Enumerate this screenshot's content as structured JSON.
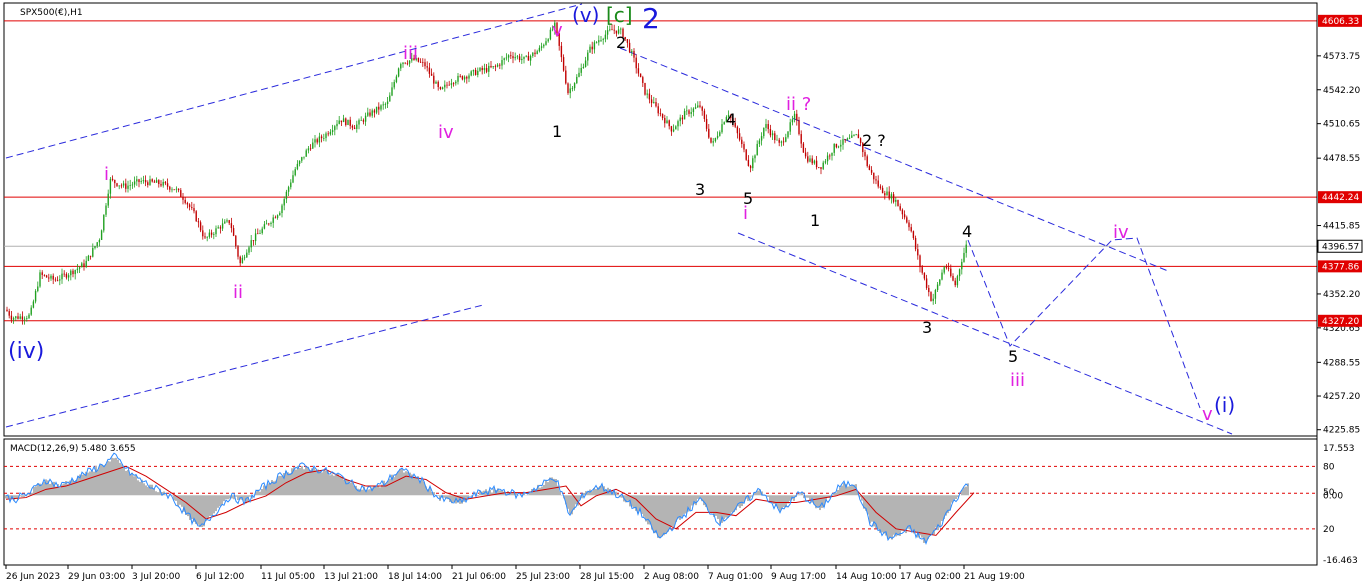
{
  "chart_data": {
    "type": "candlestick",
    "symbol": "SPX500(€),H1",
    "macd_label": "MACD(12,26,9) 5.480 3.655",
    "price_axis": {
      "ylim": [
        4220,
        4622
      ],
      "ticks": [
        4573.75,
        4542.2,
        4510.65,
        4478.55,
        4415.85,
        4352.2,
        4320.65,
        4288.55,
        4257.2,
        4225.85
      ]
    },
    "horizontal_levels": [
      {
        "price": 4606.33,
        "label": "4606.33",
        "color": "#e00000"
      },
      {
        "price": 4442.24,
        "label": "4442.24",
        "color": "#e00000"
      },
      {
        "price": 4377.86,
        "label": "4377.86",
        "color": "#e00000"
      },
      {
        "price": 4327.2,
        "label": "4327.20",
        "color": "#e00000"
      }
    ],
    "current_price": {
      "price": 4396.57,
      "label": "4396.57"
    },
    "macd_axis": {
      "ylim": [
        -18,
        20
      ],
      "ticks": [
        {
          "label": "17.553",
          "value": 17.55
        },
        {
          "label": "80",
          "value": 12
        },
        {
          "label": "50",
          "value": 4.2
        },
        {
          "label": "0.00",
          "value": 3.2
        },
        {
          "label": "20",
          "value": -7
        },
        {
          "label": "-16.463",
          "value": -16.46
        }
      ],
      "dashed_levels": [
        12,
        3.8,
        -7
      ]
    },
    "time_axis": [
      "26 Jun 2023",
      "29 Jun 03:00",
      "3 Jul 20:00",
      "6 Jul 12:00",
      "11 Jul 05:00",
      "13 Jul 21:00",
      "18 Jul 14:00",
      "21 Jul 06:00",
      "25 Jul 23:00",
      "28 Jul 15:00",
      "2 Aug 08:00",
      "7 Aug 01:00",
      "9 Aug 17:00",
      "14 Aug 10:00",
      "17 Aug 02:00",
      "21 Aug 19:00"
    ],
    "price_path": [
      [
        0,
        4345
      ],
      [
        12,
        4330
      ],
      [
        30,
        4332
      ],
      [
        40,
        4370
      ],
      [
        55,
        4365
      ],
      [
        70,
        4372
      ],
      [
        85,
        4380
      ],
      [
        100,
        4405
      ],
      [
        110,
        4458
      ],
      [
        125,
        4452
      ],
      [
        140,
        4457
      ],
      [
        160,
        4455
      ],
      [
        175,
        4450
      ],
      [
        185,
        4440
      ],
      [
        195,
        4425
      ],
      [
        205,
        4403
      ],
      [
        220,
        4415
      ],
      [
        230,
        4420
      ],
      [
        240,
        4380
      ],
      [
        250,
        4400
      ],
      [
        265,
        4415
      ],
      [
        280,
        4430
      ],
      [
        295,
        4468
      ],
      [
        310,
        4490
      ],
      [
        325,
        4500
      ],
      [
        340,
        4515
      ],
      [
        355,
        4508
      ],
      [
        370,
        4520
      ],
      [
        388,
        4530
      ],
      [
        400,
        4568
      ],
      [
        415,
        4570
      ],
      [
        425,
        4565
      ],
      [
        440,
        4540
      ],
      [
        450,
        4550
      ],
      [
        465,
        4555
      ],
      [
        480,
        4560
      ],
      [
        495,
        4563
      ],
      [
        510,
        4575
      ],
      [
        525,
        4570
      ],
      [
        540,
        4580
      ],
      [
        555,
        4602
      ],
      [
        568,
        4540
      ],
      [
        578,
        4555
      ],
      [
        590,
        4580
      ],
      [
        600,
        4590
      ],
      [
        612,
        4598
      ],
      [
        622,
        4596
      ],
      [
        632,
        4575
      ],
      [
        645,
        4540
      ],
      [
        660,
        4520
      ],
      [
        672,
        4505
      ],
      [
        685,
        4520
      ],
      [
        700,
        4527
      ],
      [
        712,
        4490
      ],
      [
        728,
        4522
      ],
      [
        740,
        4495
      ],
      [
        750,
        4470
      ],
      [
        765,
        4510
      ],
      [
        780,
        4490
      ],
      [
        795,
        4518
      ],
      [
        805,
        4480
      ],
      [
        820,
        4470
      ],
      [
        835,
        4490
      ],
      [
        850,
        4496
      ],
      [
        858,
        4500
      ],
      [
        868,
        4470
      ],
      [
        880,
        4450
      ],
      [
        895,
        4440
      ],
      [
        910,
        4415
      ],
      [
        920,
        4378
      ],
      [
        932,
        4345
      ],
      [
        945,
        4380
      ],
      [
        955,
        4360
      ],
      [
        962,
        4385
      ],
      [
        968,
        4402
      ]
    ],
    "macd_line": [
      [
        0,
        3
      ],
      [
        15,
        2
      ],
      [
        30,
        4
      ],
      [
        45,
        8
      ],
      [
        60,
        6
      ],
      [
        80,
        9
      ],
      [
        100,
        12
      ],
      [
        115,
        15
      ],
      [
        130,
        10
      ],
      [
        150,
        6
      ],
      [
        170,
        3
      ],
      [
        185,
        -2
      ],
      [
        200,
        -7
      ],
      [
        215,
        -2
      ],
      [
        230,
        3
      ],
      [
        245,
        1
      ],
      [
        260,
        5
      ],
      [
        280,
        9
      ],
      [
        300,
        12
      ],
      [
        320,
        11
      ],
      [
        340,
        9
      ],
      [
        355,
        6
      ],
      [
        370,
        5
      ],
      [
        385,
        7
      ],
      [
        400,
        11
      ],
      [
        420,
        8
      ],
      [
        440,
        2
      ],
      [
        460,
        1
      ],
      [
        480,
        4
      ],
      [
        500,
        5
      ],
      [
        520,
        3
      ],
      [
        540,
        6
      ],
      [
        555,
        9
      ],
      [
        570,
        -3
      ],
      [
        585,
        4
      ],
      [
        600,
        6
      ],
      [
        620,
        3
      ],
      [
        640,
        -2
      ],
      [
        660,
        -10
      ],
      [
        680,
        -4
      ],
      [
        700,
        2
      ],
      [
        720,
        -5
      ],
      [
        740,
        0
      ],
      [
        760,
        5
      ],
      [
        780,
        -2
      ],
      [
        800,
        4
      ],
      [
        820,
        -1
      ],
      [
        840,
        6
      ],
      [
        855,
        7
      ],
      [
        870,
        -5
      ],
      [
        890,
        -10
      ],
      [
        910,
        -7
      ],
      [
        925,
        -11
      ],
      [
        940,
        -6
      ],
      [
        955,
        2
      ],
      [
        968,
        7
      ]
    ],
    "signal_line": [
      [
        0,
        2
      ],
      [
        20,
        2.5
      ],
      [
        40,
        5
      ],
      [
        60,
        6
      ],
      [
        80,
        8
      ],
      [
        100,
        10
      ],
      [
        120,
        12
      ],
      [
        140,
        9
      ],
      [
        160,
        5
      ],
      [
        180,
        1
      ],
      [
        200,
        -4
      ],
      [
        220,
        -2
      ],
      [
        240,
        1
      ],
      [
        260,
        3
      ],
      [
        280,
        7
      ],
      [
        300,
        10
      ],
      [
        320,
        11
      ],
      [
        340,
        8
      ],
      [
        360,
        6
      ],
      [
        380,
        6
      ],
      [
        400,
        9
      ],
      [
        420,
        8
      ],
      [
        440,
        4
      ],
      [
        460,
        2
      ],
      [
        480,
        3
      ],
      [
        500,
        4
      ],
      [
        520,
        4
      ],
      [
        540,
        5
      ],
      [
        560,
        6
      ],
      [
        575,
        0
      ],
      [
        590,
        3
      ],
      [
        610,
        5
      ],
      [
        630,
        2
      ],
      [
        650,
        -4
      ],
      [
        670,
        -7
      ],
      [
        690,
        -2
      ],
      [
        710,
        -2
      ],
      [
        730,
        -3
      ],
      [
        750,
        2
      ],
      [
        770,
        1
      ],
      [
        790,
        1
      ],
      [
        810,
        2
      ],
      [
        830,
        3
      ],
      [
        850,
        5
      ],
      [
        870,
        -2
      ],
      [
        890,
        -7
      ],
      [
        910,
        -8
      ],
      [
        930,
        -9
      ],
      [
        950,
        -2
      ],
      [
        968,
        4
      ]
    ],
    "wave_labels": [
      {
        "text": "(iv)",
        "color": "#1a1adc"
      },
      {
        "text": "i",
        "color": "#e020e0"
      },
      {
        "text": "ii",
        "color": "#e020e0"
      },
      {
        "text": "iii",
        "color": "#e020e0"
      },
      {
        "text": "iv",
        "color": "#e020e0"
      },
      {
        "text": "v",
        "color": "#e020e0"
      },
      {
        "text": "(v)",
        "color": "#1a1adc"
      },
      {
        "text": "[c]",
        "color": "#1a8a1a"
      },
      {
        "text": "2",
        "color": "#1a1adc"
      },
      {
        "text": "1",
        "color": "#000000"
      },
      {
        "text": "2",
        "color": "#000000"
      },
      {
        "text": "3",
        "color": "#000000"
      },
      {
        "text": "4",
        "color": "#000000"
      },
      {
        "text": "5",
        "color": "#000000"
      },
      {
        "text": "i",
        "color": "#e020e0"
      },
      {
        "text": "ii ?",
        "color": "#e020e0"
      },
      {
        "text": "1",
        "color": "#000000"
      },
      {
        "text": "2 ?",
        "color": "#000000"
      },
      {
        "text": "3",
        "color": "#000000"
      },
      {
        "text": "4",
        "color": "#000000"
      },
      {
        "text": "5",
        "color": "#000000"
      },
      {
        "text": "iii",
        "color": "#e020e0"
      },
      {
        "text": "iv",
        "color": "#e020e0"
      },
      {
        "text": "v",
        "color": "#e020e0"
      },
      {
        "text": "(i)",
        "color": "#1a1adc"
      }
    ],
    "colors": {
      "bull": "#20a020",
      "bear": "#c00000",
      "macd": "#2a8aff",
      "signal": "#d00000",
      "histogram": "#b4b4b4",
      "channel": "#2a2adc",
      "level": "#e00000",
      "current": "#b0b0b0"
    }
  }
}
